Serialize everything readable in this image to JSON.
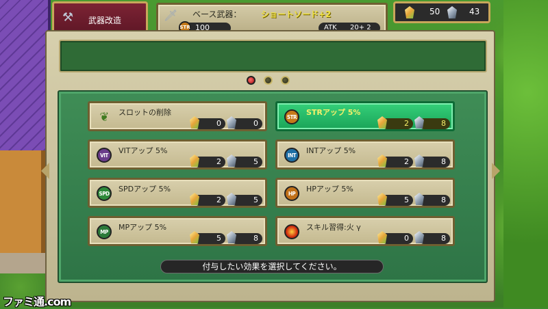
{
  "header": {
    "tab_label": "武器改造",
    "tab_icon": "hammer-icon",
    "weapon_label": "ベース武器：",
    "weapon_name": "ショートソード+2",
    "weapon_icon": "sword-icon",
    "str_badge": "STR",
    "str_value": "100",
    "atk_label": "ATK",
    "atk_value": "20+  2"
  },
  "resources": {
    "gold_gem": "50",
    "silver_gem": "43"
  },
  "pager": {
    "pages": 3,
    "active": 0
  },
  "slots": [
    {
      "label": "スロットの削除",
      "icon_text": "",
      "icon": "leaf-icon",
      "cost_a": "0",
      "cost_b": "0"
    },
    {
      "label": "STRアップ 5%",
      "icon_text": "STR",
      "icon": "str-icon",
      "cost_a": "2",
      "cost_b": "8"
    },
    {
      "label": "VITアップ 5%",
      "icon_text": "VIT",
      "icon": "vit-icon",
      "cost_a": "2",
      "cost_b": "5"
    },
    {
      "label": "INTアップ 5%",
      "icon_text": "INT",
      "icon": "int-icon",
      "cost_a": "2",
      "cost_b": "8"
    },
    {
      "label": "SPDアップ 5%",
      "icon_text": "SPD",
      "icon": "spd-icon",
      "cost_a": "2",
      "cost_b": "5"
    },
    {
      "label": "HPアップ 5%",
      "icon_text": "HP",
      "icon": "hp-icon",
      "cost_a": "5",
      "cost_b": "8"
    },
    {
      "label": "MPアップ 5%",
      "icon_text": "MP",
      "icon": "mp-icon",
      "cost_a": "5",
      "cost_b": "8"
    },
    {
      "label": "スキル習得:火 γ",
      "icon_text": "",
      "icon": "fire-icon",
      "cost_a": "0",
      "cost_b": "8"
    }
  ],
  "hint": "付与したい効果を選択してください。",
  "watermark": "ファミ通.com",
  "colors": {
    "selected_slot": "#1fb861",
    "list_bg": "#3f8d56",
    "tab_bg": "#7c2334",
    "weapon_name": "#f0e240"
  }
}
